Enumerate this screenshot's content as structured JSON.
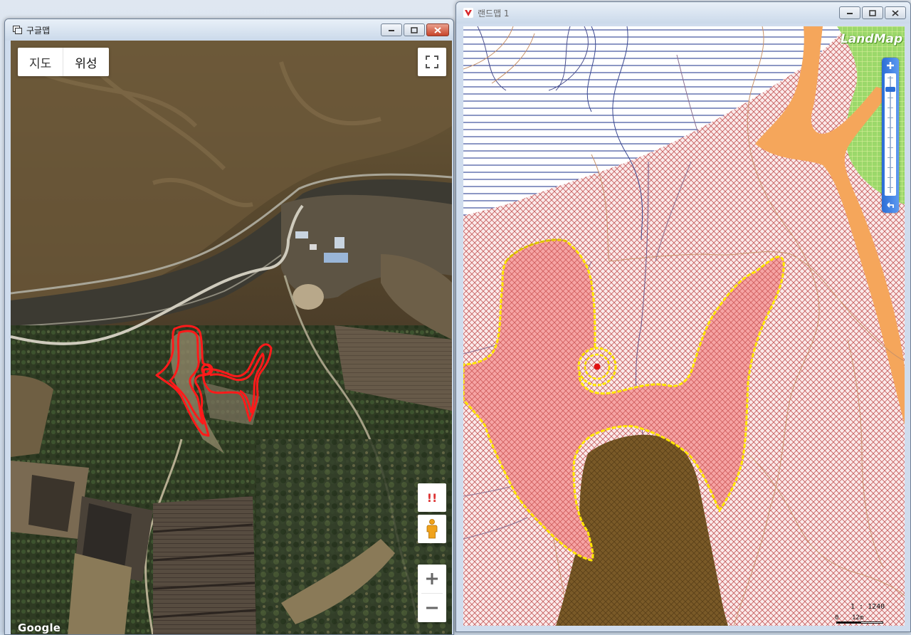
{
  "google_window": {
    "title": "구글맵",
    "map_type": {
      "map_label": "지도",
      "satellite_label": "위성",
      "selected": "위성"
    },
    "report_label": "!!",
    "google_logo": "Google"
  },
  "landmap_window": {
    "title": "랜드맵 1",
    "logo": "LandMap",
    "scale_text": "1 : 1240",
    "scale_min": "0",
    "scale_max": "12m"
  },
  "colors": {
    "window_frame": "#cfdced",
    "close_button": "#c8442a",
    "parcel_outline_google": "#ff1a1a",
    "parcel_outline_landmap": "#ffe600",
    "parcel_fill": "#f4a0a0",
    "hatch": "#c45a5a",
    "road": "#f5a65b",
    "green_zone": "#9bd86a",
    "water_lines": "#1a2f8a",
    "brown_zone": "#7a5a28"
  },
  "icons": {
    "google_title_icon": "window-icon",
    "landmap_title_icon": "landmap-logo-icon",
    "fullscreen": "fullscreen-icon",
    "pegman": "pegman-icon",
    "zoom_in": "plus-icon",
    "zoom_out": "minus-icon"
  }
}
